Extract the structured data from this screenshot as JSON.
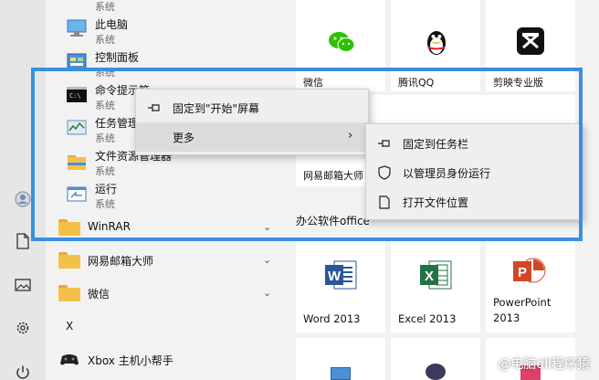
{
  "app_list": {
    "items": [
      {
        "name": "",
        "sub": "系统"
      },
      {
        "name": "此电脑",
        "sub": "系统"
      },
      {
        "name": "控制面板",
        "sub": "系统"
      },
      {
        "name": "命令提示符",
        "sub": "系统"
      },
      {
        "name": "任务管理器",
        "sub": "系统"
      },
      {
        "name": "文件资源管理器",
        "sub": "系统"
      },
      {
        "name": "运行",
        "sub": "系统"
      }
    ],
    "folders": [
      {
        "name": "WinRAR"
      },
      {
        "name": "网易邮箱大师"
      },
      {
        "name": "微信"
      }
    ],
    "letter": "X",
    "xbox": "Xbox 主机小帮手"
  },
  "tiles": {
    "wechat": "微信",
    "qq": "腾讯QQ",
    "jianying": "剪映专业版",
    "mailmaster": "网易邮箱大师",
    "office": "办公软件office",
    "word": "Word 2013",
    "excel": "Excel 2013",
    "powerpoint": "PowerPoint",
    "powerpoint_ver": "2013"
  },
  "context_menu": {
    "pin_start": "固定到\"开始\"屏幕",
    "more": "更多"
  },
  "submenu": {
    "pin_taskbar": "固定到任务栏",
    "run_admin": "以管理员身份运行",
    "open_location": "打开文件位置"
  },
  "watermark": "@电脑dll程序猿",
  "colors": {
    "highlight": "#3a8fe0",
    "word": "#2b579a",
    "excel": "#217346",
    "powerpoint": "#d24726",
    "wechat": "#2dc100"
  }
}
